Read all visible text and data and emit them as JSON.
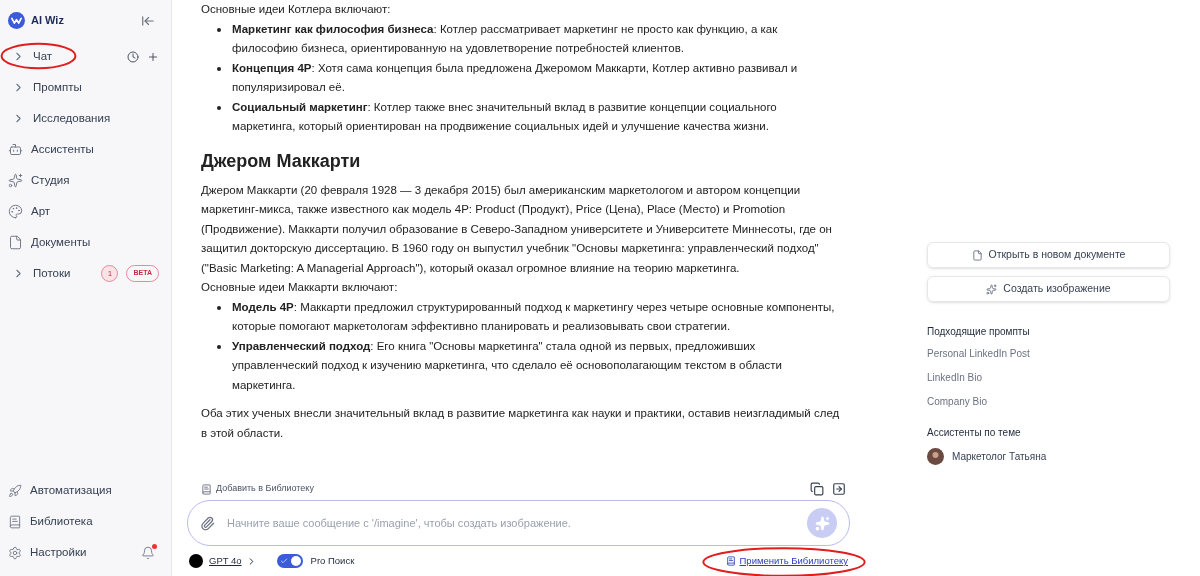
{
  "sidebar": {
    "brand": "AI Wiz",
    "items": [
      {
        "label": "Чат",
        "kind": "expand",
        "highlighted": true
      },
      {
        "label": "Промпты",
        "kind": "expand",
        "highlighted": false
      },
      {
        "label": "Исследования",
        "kind": "expand",
        "highlighted": false
      },
      {
        "label": "Ассистенты",
        "kind": "icon",
        "highlighted": false
      },
      {
        "label": "Студия",
        "kind": "icon",
        "highlighted": false
      },
      {
        "label": "Арт",
        "kind": "icon",
        "highlighted": false
      },
      {
        "label": "Документы",
        "kind": "icon",
        "highlighted": false
      },
      {
        "label": "Потоки",
        "kind": "expand",
        "highlighted": false,
        "count": "1",
        "badge": "BETA"
      }
    ],
    "bottom_items": [
      {
        "label": "Автоматизация"
      },
      {
        "label": "Библиотека"
      },
      {
        "label": "Настройки"
      }
    ],
    "notification_dot": true
  },
  "article": {
    "blocks": [
      {
        "kind": "paragraph",
        "text": "Основные идеи Котлера включают:"
      },
      {
        "kind": "list",
        "items": [
          "**Маркетинг как философия бизнеса**: Котлер рассматривает маркетинг не просто как функцию, а как философию бизнеса, ориентированную на удовлетворение потребностей клиентов.",
          "**Концепция 4P**: Хотя сама концепция была предложена Джеромом Маккарти, Котлер активно развивал и популяризировал её.",
          "**Социальный маркетинг**: Котлер также внес значительный вклад в развитие концепции социального маркетинга, который ориентирован на продвижение социальных идей и улучшение качества жизни."
        ]
      },
      {
        "kind": "heading",
        "text": "Джером Маккарти"
      },
      {
        "kind": "paragraph",
        "text": "Джером Маккарти (20 февраля 1928 — 3 декабря 2015) был американским маркетологом и автором концепции маркетинг-микса, также известного как модель 4P: Product (Продукт), Price (Цена), Place (Место) и Promotion (Продвижение). Маккарти получил образование в Северо-Западном университете и Университете Миннесоты, где он защитил докторскую диссертацию. В 1960 году он выпустил учебник \"Основы маркетинга: управленческий подход\" (\"Basic Marketing: A Managerial Approach\"), который оказал огромное влияние на теорию маркетинга."
      },
      {
        "kind": "paragraph",
        "text": "Основные идеи Маккарти включают:"
      },
      {
        "kind": "list",
        "items": [
          "**Модель 4P**: Маккарти предложил структурированный подход к маркетингу через четыре основные компоненты, которые помогают маркетологам эффективно планировать и реализовывать свои стратегии.",
          "**Управленческий подход**: Его книга \"Основы маркетинга\" стала одной из первых, предложивших управленческий подход к изучению маркетинга, что сделало её основополагающим текстом в области маркетинга."
        ]
      },
      {
        "kind": "spaced_paragraph",
        "text": "Оба этих ученых внесли значительный вклад в развитие маркетинга как науки и практики, оставив неизгладимый след в этой области."
      }
    ],
    "add_to_library": "Добавить в Библиотеку"
  },
  "composer": {
    "placeholder": "Начните ваше сообщение с '/imagine', чтобы создать изображение.",
    "model": "GPT 4o",
    "pro_search": {
      "label": "Pro Поиск",
      "on": true
    },
    "apply_library": "Применить Бибилиотеку",
    "apply_library_highlighted": true
  },
  "right_panel": {
    "buttons": [
      "Открыть в новом документе",
      "Создать изображение"
    ],
    "prompts_title": "Подходящие промпты",
    "prompts": [
      "Personal LinkedIn Post",
      "LinkedIn Bio",
      "Company Bio"
    ],
    "assistants_title": "Ассистенты по теме",
    "assistants": [
      "Маркетолог Татьяна"
    ]
  }
}
